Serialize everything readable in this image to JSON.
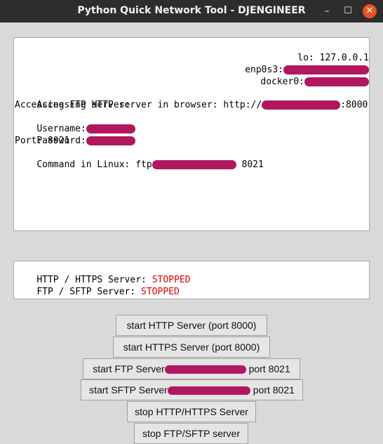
{
  "window": {
    "title": "Python Quick Network Tool - DJENGINEER",
    "minimize": "–",
    "maximize": "☐",
    "close": "✕"
  },
  "info": {
    "lo_label": "lo: 127.0.0.1",
    "enp_label": "enp0s3:",
    "docker_label": "docker0:",
    "http_access_prefix": "Accessing HTTP server in browser: http://",
    "http_access_suffix": ":8000",
    "ftp_access": "Accessing FTP server:",
    "username_label": "Username:",
    "password_label": "Password:",
    "port_line": "Port: 8021",
    "command_prefix": "Command in Linux: ftp",
    "command_suffix": " 8021"
  },
  "status": {
    "http_label": "HTTP / HTTPS Server: ",
    "http_state": "STOPPED",
    "ftp_label": "FTP / SFTP Server: ",
    "ftp_state": "STOPPED",
    "state_color": "#e00000"
  },
  "buttons": {
    "start_http": "start HTTP Server (port 8000)",
    "start_https": "start HTTPS Server (port 8000)",
    "start_ftp_prefix": "start FTP Server",
    "start_ftp_suffix": " port 8021",
    "start_sftp_prefix": "start SFTP Server",
    "start_sftp_suffix": " port 8021",
    "stop_http": "stop HTTP/HTTPS Server",
    "stop_ftp": "stop FTP/SFTP server"
  }
}
